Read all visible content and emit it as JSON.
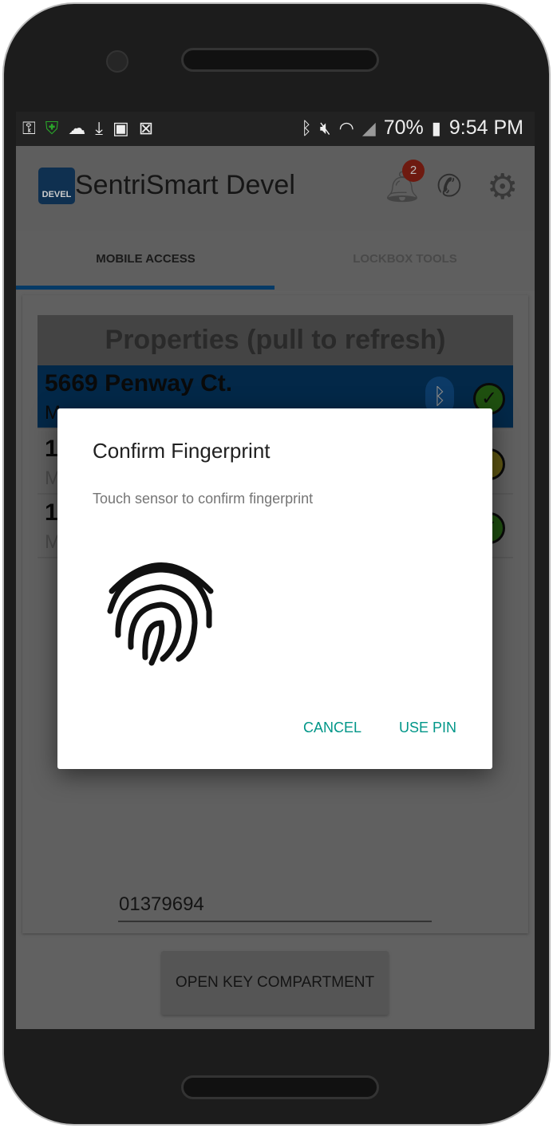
{
  "status_bar": {
    "battery": "70%",
    "time": "9:54 PM",
    "left_icons": [
      "key-icon",
      "vpn-shield-icon",
      "cloud-icon",
      "download-icon",
      "image-icon",
      "file-x-icon"
    ],
    "right_icons": [
      "bluetooth-icon",
      "mute-icon",
      "wifi-icon",
      "signal-icon",
      "battery-icon"
    ]
  },
  "app_bar": {
    "logo_text": "DEVEL",
    "title": "SentriSmart Devel",
    "notification_count": "2"
  },
  "tabs": [
    {
      "label": "MOBILE ACCESS",
      "active": true
    },
    {
      "label": "LOCKBOX TOOLS",
      "active": false
    }
  ],
  "properties": {
    "header": "Properties (pull to refresh)",
    "rows": [
      {
        "address": "5669 Penway Ct.",
        "sub": "M",
        "status": "green",
        "selected": true
      },
      {
        "address": "1",
        "sub": "M",
        "status": "yellow"
      },
      {
        "address": "1",
        "sub": "M",
        "status": "green"
      }
    ]
  },
  "pin_field": {
    "value": "01379694"
  },
  "open_button": "OPEN KEY COMPARTMENT",
  "dialog": {
    "title": "Confirm Fingerprint",
    "body": "Touch sensor to confirm fingerprint",
    "cancel": "CANCEL",
    "use_pin": "USE PIN"
  },
  "colors": {
    "accent": "#009688",
    "tab_indicator": "#0a5a9c",
    "selected_row": "#0a4f8f"
  }
}
